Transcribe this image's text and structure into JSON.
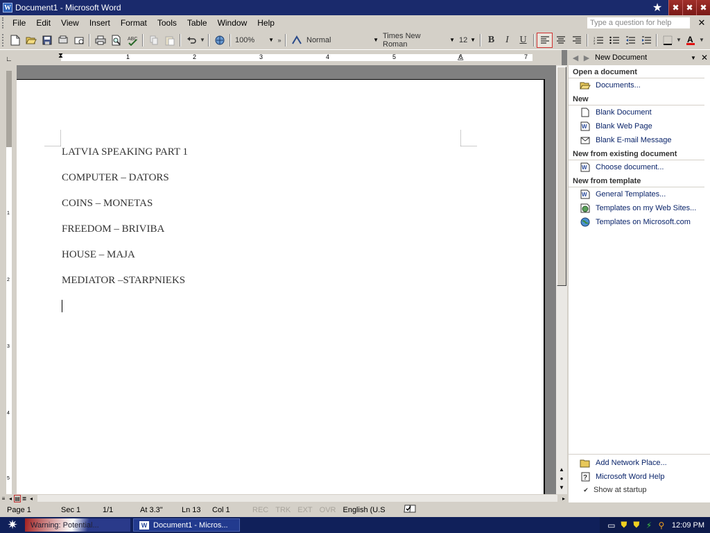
{
  "window": {
    "title": "Document1 - Microsoft Word",
    "controls": [
      "✖",
      "✖",
      "✖"
    ]
  },
  "menu": {
    "items": [
      "File",
      "Edit",
      "View",
      "Insert",
      "Format",
      "Tools",
      "Table",
      "Window",
      "Help"
    ],
    "help_placeholder": "Type a question for help"
  },
  "toolbar": {
    "zoom": "100%",
    "style": "Normal",
    "font": "Times New Roman",
    "size": "12",
    "bold": "B",
    "italic": "I",
    "underline": "U"
  },
  "ruler": {
    "numbers": [
      "1",
      "2",
      "3",
      "4",
      "5",
      "6",
      "7"
    ],
    "v_numbers": [
      "1",
      "2",
      "3",
      "4",
      "5"
    ]
  },
  "document": {
    "lines": [
      "LATVIA SPEAKING PART 1",
      "COMPUTER – DATORS",
      "COINS – MONETAS",
      "FREEDOM – BRIVIBA",
      "HOUSE – MAJA",
      "MEDIATOR –STARPNIEKS"
    ]
  },
  "taskpane": {
    "title": "New Document",
    "open_section": "Open a document",
    "open_items": [
      "Documents..."
    ],
    "new_section": "New",
    "new_items": [
      "Blank Document",
      "Blank Web Page",
      "Blank E-mail Message"
    ],
    "existing_section": "New from existing document",
    "existing_items": [
      "Choose document..."
    ],
    "template_section": "New from template",
    "template_items": [
      "General Templates...",
      "Templates on my Web Sites...",
      "Templates on Microsoft.com"
    ],
    "bottom_items": [
      "Add Network Place...",
      "Microsoft Word Help"
    ],
    "show_startup": "Show at startup"
  },
  "statusbar": {
    "page": "Page 1",
    "sec": "Sec 1",
    "pages": "1/1",
    "at": "At 3.3\"",
    "ln": "Ln 13",
    "col": "Col 1",
    "rec": "REC",
    "trk": "TRK",
    "ext": "EXT",
    "ovr": "OVR",
    "lang": "English (U.S"
  },
  "taskbar": {
    "tasks": [
      "Warning: Potential...",
      "Document1 - Micros..."
    ],
    "time": "12:09 PM"
  }
}
